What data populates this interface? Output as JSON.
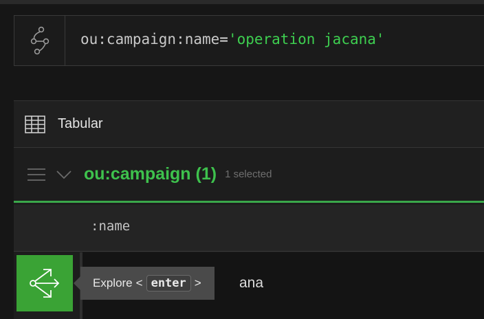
{
  "query": {
    "icon": "graph-node-icon",
    "prop": "ou:campaign:name",
    "op": "=",
    "value": "'operation jacana'"
  },
  "view": {
    "icon": "table-icon",
    "label": "Tabular"
  },
  "group": {
    "menu_icon": "hamburger-menu-icon",
    "chevron_icon": "chevron-down-icon",
    "title": "ou:campaign (1)",
    "selected": "1 selected"
  },
  "table": {
    "column": ":name",
    "row_value": "ana"
  },
  "explore": {
    "icon": "explore-share-icon",
    "tooltip_label": "Explore",
    "open": "<",
    "key": "enter",
    "close": ">"
  },
  "colors": {
    "accent": "#3ec24d",
    "button": "#3aa335",
    "string": "#3ecf50",
    "background": "#161616"
  }
}
